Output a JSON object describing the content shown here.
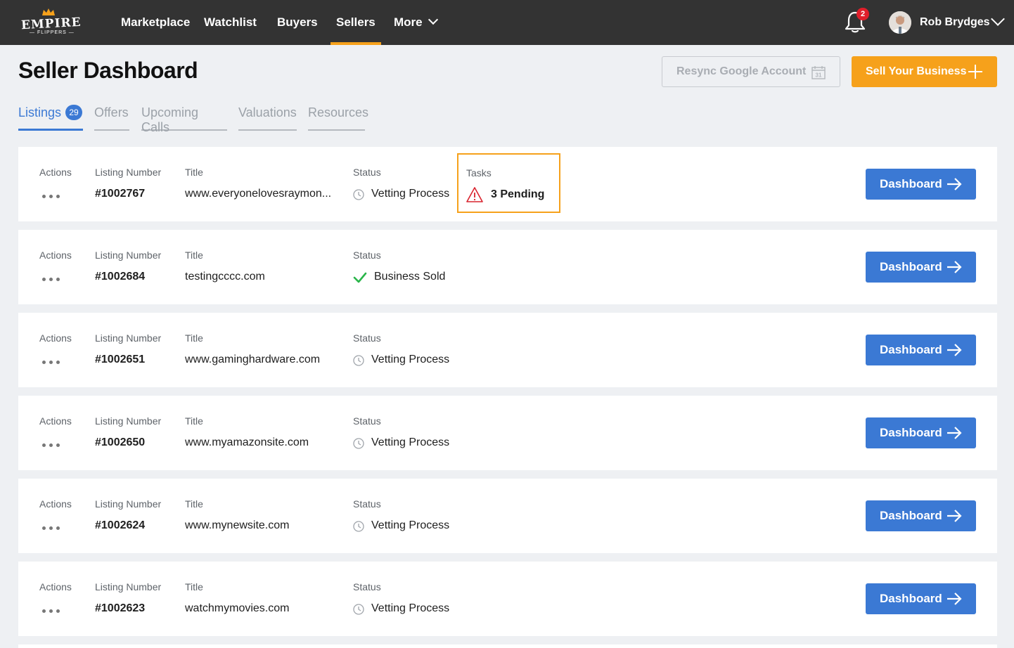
{
  "nav": {
    "logo_text": "EMPIRE",
    "logo_sub": "— FLIPPERS —",
    "items": [
      {
        "label": "Marketplace"
      },
      {
        "label": "Watchlist"
      },
      {
        "label": "Buyers"
      },
      {
        "label": "Sellers",
        "active": true
      },
      {
        "label": "More"
      }
    ],
    "notification_count": "2",
    "user_name": "Rob Brydges"
  },
  "header": {
    "title": "Seller Dashboard",
    "resync_label": "Resync Google Account",
    "sell_label": "Sell Your Business"
  },
  "tabs": [
    {
      "label": "Listings",
      "badge": "29",
      "active": true
    },
    {
      "label": "Offers"
    },
    {
      "label": "Upcoming Calls"
    },
    {
      "label": "Valuations"
    },
    {
      "label": "Resources"
    }
  ],
  "columns": {
    "actions": "Actions",
    "listing_number": "Listing Number",
    "title": "Title",
    "status": "Status",
    "tasks": "Tasks"
  },
  "listings": [
    {
      "number": "#1002767",
      "title": "www.everyonelovesraymon...",
      "status": "Vetting Process",
      "tasks": "3 Pending"
    },
    {
      "number": "#1002684",
      "title": "testingcccc.com",
      "status": "Business Sold"
    },
    {
      "number": "#1002651",
      "title": "www.gaminghardware.com",
      "status": "Vetting Process"
    },
    {
      "number": "#1002650",
      "title": "www.myamazonsite.com",
      "status": "Vetting Process"
    },
    {
      "number": "#1002624",
      "title": "www.mynewsite.com",
      "status": "Vetting Process"
    },
    {
      "number": "#1002623",
      "title": "watchmymovies.com",
      "status": "Vetting Process"
    }
  ],
  "dashboard_label": "Dashboard",
  "colors": {
    "nav_bg": "#333333",
    "accent_orange": "#f6a11b",
    "primary_blue": "#3b79d4",
    "success_green": "#2ab54a",
    "warning_red": "#d9232e"
  }
}
